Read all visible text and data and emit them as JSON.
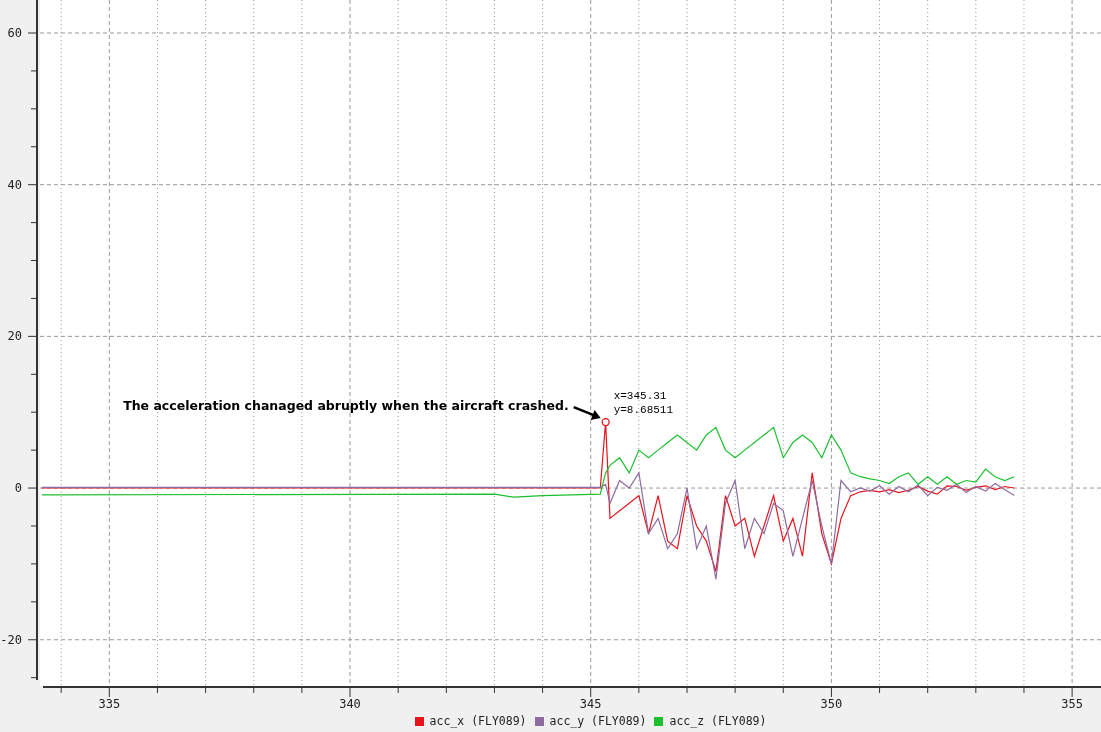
{
  "chart_data": {
    "type": "line",
    "x": [
      333.6,
      343,
      343.4,
      344,
      345.2,
      345.31,
      345.4,
      345.6,
      345.8,
      346,
      346.2,
      346.4,
      346.6,
      346.8,
      347,
      347.2,
      347.4,
      347.6,
      347.8,
      348,
      348.2,
      348.4,
      348.6,
      348.8,
      349,
      349.2,
      349.4,
      349.6,
      349.8,
      350,
      350.2,
      350.4,
      350.6,
      350.8,
      351,
      351.2,
      351.4,
      351.6,
      351.8,
      352,
      352.2,
      352.4,
      352.6,
      352.8,
      353,
      353.2,
      353.4,
      353.6,
      353.8
    ],
    "series": [
      {
        "name": "acc_x (FLY089)",
        "color": "#e8141c",
        "values": [
          0,
          0,
          0,
          0,
          0,
          8.7,
          -4,
          -3,
          -2,
          -1,
          -6,
          -1,
          -7,
          -8,
          -1,
          -5,
          -7,
          -11,
          -1,
          -5,
          -4,
          -9,
          -5,
          -1,
          -7,
          -4,
          -9,
          2,
          -6,
          -10,
          -4,
          -1,
          -0.5,
          -0.3,
          -0.5,
          -0.2,
          -0.6,
          -0.3,
          0.2,
          -0.4,
          -0.8,
          0.3,
          0.2,
          -0.3,
          0.1,
          0.3,
          -0.2,
          0.2,
          0
        ]
      },
      {
        "name": "acc_y (FLY089)",
        "color": "#8e6ba0",
        "values": [
          0.1,
          0.1,
          0.1,
          0.1,
          0.1,
          0.5,
          -2,
          1,
          0,
          2,
          -6,
          -4,
          -8,
          -6,
          0,
          -8,
          -5,
          -12,
          -2,
          1,
          -8,
          -4,
          -6,
          -2,
          -3,
          -9,
          -4,
          1,
          -5,
          -10,
          1,
          -0.5,
          0,
          -0.4,
          0.3,
          -0.8,
          0.2,
          -0.5,
          0.4,
          -1,
          0.1,
          -0.3,
          0.5,
          -0.6,
          0.2,
          -0.4,
          0.6,
          -0.2,
          -1
        ]
      },
      {
        "name": "acc_z (FLY089)",
        "color": "#1cbf2e",
        "values": [
          -0.9,
          -0.8,
          -1.2,
          -1,
          -0.8,
          2,
          3,
          4,
          2,
          5,
          4,
          5,
          6,
          7,
          6,
          5,
          7,
          8,
          5,
          4,
          5,
          6,
          7,
          8,
          4,
          6,
          7,
          6,
          4,
          7,
          5,
          2,
          1.5,
          1.2,
          1,
          0.6,
          1.5,
          2,
          0.5,
          1.5,
          0.5,
          1.5,
          0.5,
          1,
          0.8,
          2.5,
          1.5,
          1,
          1.5
        ]
      }
    ],
    "xlim": [
      333.56,
      355.6
    ],
    "ylim": [
      -26.1,
      64.35
    ],
    "xticks": [
      335,
      340,
      345,
      350,
      355
    ],
    "yticks": [
      -20,
      0,
      20,
      40,
      60
    ],
    "grid": true,
    "legend": true,
    "annotations": [
      "The acceleration chanaged abruptly when the aircraft crashed.",
      "x=345.31",
      "y=8.68511"
    ]
  }
}
